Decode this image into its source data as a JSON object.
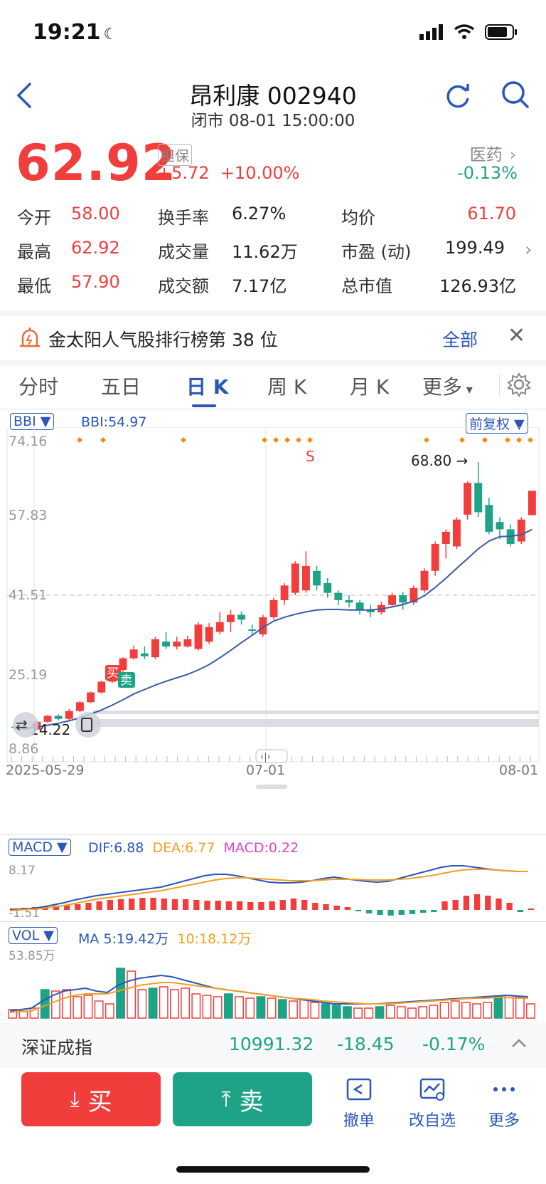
{
  "status": {
    "time": "19:21"
  },
  "header": {
    "title": "昂利康 002940",
    "subtitle": "闭市 08-01 15:00:00"
  },
  "quote": {
    "price": "62.92",
    "badge": "担保",
    "change": "+5.72",
    "change_pct": "+10.00%",
    "sector": "医药",
    "sector_change": "-0.13%"
  },
  "stats": [
    {
      "label": "今开",
      "value": "58.00",
      "tone": "red"
    },
    {
      "label": "换手率",
      "value": "6.27%",
      "tone": "dark"
    },
    {
      "label": "均价",
      "value": "61.70",
      "tone": "red"
    },
    {
      "label": "最高",
      "value": "62.92",
      "tone": "red"
    },
    {
      "label": "成交量",
      "value": "11.62万",
      "tone": "dark"
    },
    {
      "label": "市盈 (动)",
      "value": "199.49",
      "tone": "dark"
    },
    {
      "label": "最低",
      "value": "57.90",
      "tone": "red"
    },
    {
      "label": "成交额",
      "value": "7.17亿",
      "tone": "dark"
    },
    {
      "label": "总市值",
      "value": "126.93亿",
      "tone": "dark"
    }
  ],
  "banner": {
    "text": "金太阳人气股排行榜第 38 位",
    "link": "全部"
  },
  "tabs": [
    "分时",
    "五日",
    "日 K",
    "周 K",
    "月 K",
    "更多"
  ],
  "active_tab": "日 K",
  "kline": {
    "indicator": "BBI",
    "indicator_value": "BBI:54.97",
    "adjust": "前复权",
    "y_ticks": [
      "74.16",
      "57.83",
      "41.51",
      "25.19",
      "8.86"
    ],
    "x_ticks": [
      "2025-05-29",
      "07-01",
      "08-01"
    ],
    "high_label": "68.80",
    "low_label": "14.22",
    "buy_label": "买",
    "sell_label": "卖",
    "s_label": "S",
    "colors": {
      "up": "#f23d3d",
      "down": "#1fa387",
      "ma": "#3a5aa8"
    }
  },
  "chart_data": {
    "type": "candlestick",
    "ylim": [
      8.86,
      74.16
    ],
    "y_ticks": [
      74.16,
      57.83,
      41.51,
      25.19,
      8.86
    ],
    "x_ticks": [
      "2025-05-29",
      "07-01",
      "08-01"
    ],
    "candles": [
      [
        14.6,
        14.3,
        14.9,
        14.0
      ],
      [
        14.3,
        14.0,
        14.6,
        13.8
      ],
      [
        14.0,
        15.6,
        15.9,
        13.9
      ],
      [
        15.6,
        16.8,
        17.0,
        15.4
      ],
      [
        16.8,
        16.2,
        17.1,
        15.9
      ],
      [
        16.2,
        17.8,
        18.2,
        16.0
      ],
      [
        17.8,
        19.6,
        19.8,
        17.6
      ],
      [
        19.6,
        21.6,
        21.8,
        19.4
      ],
      [
        21.6,
        23.8,
        24.0,
        21.4
      ],
      [
        23.8,
        26.2,
        26.4,
        23.6
      ],
      [
        26.2,
        28.6,
        28.8,
        25.8
      ],
      [
        28.6,
        30.4,
        31.2,
        28.3
      ],
      [
        29.6,
        29.0,
        31.0,
        28.4
      ],
      [
        28.8,
        32.5,
        33.0,
        28.4
      ],
      [
        32.0,
        31.0,
        34.0,
        30.5
      ],
      [
        31.0,
        32.0,
        33.0,
        30.4
      ],
      [
        31.0,
        32.5,
        33.2,
        30.8
      ],
      [
        30.5,
        35.5,
        36.0,
        30.2
      ],
      [
        32.0,
        35.0,
        35.8,
        31.5
      ],
      [
        34.0,
        36.0,
        38.0,
        33.5
      ],
      [
        36.0,
        37.5,
        38.5,
        34.0
      ],
      [
        37.5,
        36.5,
        38.2,
        35.5
      ],
      [
        34.5,
        34.2,
        35.5,
        33.5
      ],
      [
        33.5,
        37.0,
        37.5,
        33.0
      ],
      [
        37.0,
        40.5,
        41.0,
        36.5
      ],
      [
        40.5,
        43.5,
        44.0,
        39.5
      ],
      [
        42.0,
        48.0,
        48.5,
        41.5
      ],
      [
        42.5,
        47.5,
        50.5,
        42.0
      ],
      [
        46.5,
        43.5,
        47.5,
        42.5
      ],
      [
        44.0,
        42.0,
        45.0,
        41.0
      ],
      [
        42.0,
        40.5,
        42.5,
        39.5
      ],
      [
        40.5,
        40.0,
        41.5,
        39.0
      ],
      [
        40.0,
        38.5,
        40.5,
        37.5
      ],
      [
        38.5,
        38.0,
        39.5,
        37.0
      ],
      [
        38.0,
        39.5,
        40.2,
        37.5
      ],
      [
        39.5,
        41.5,
        42.0,
        39.0
      ],
      [
        41.5,
        40.0,
        42.2,
        38.5
      ],
      [
        40.0,
        43.0,
        43.5,
        39.5
      ],
      [
        42.5,
        46.5,
        47.0,
        42.0
      ],
      [
        46.5,
        52.0,
        52.5,
        45.5
      ],
      [
        52.0,
        54.5,
        55.0,
        49.0
      ],
      [
        51.5,
        57.0,
        57.5,
        51.0
      ],
      [
        58.0,
        64.5,
        64.8,
        57.0
      ],
      [
        64.5,
        58.5,
        68.8,
        57.5
      ],
      [
        60.0,
        54.5,
        61.5,
        54.0
      ],
      [
        56.5,
        55.0,
        57.5,
        53.0
      ],
      [
        55.0,
        52.0,
        56.0,
        51.5
      ],
      [
        52.5,
        57.0,
        57.5,
        52.0
      ],
      [
        57.9,
        62.9,
        62.9,
        57.9
      ]
    ],
    "bbi": [
      14.2,
      14.3,
      14.5,
      14.9,
      15.3,
      15.8,
      16.4,
      17.2,
      18.0,
      19.0,
      20.1,
      21.3,
      22.2,
      23.1,
      23.9,
      24.6,
      25.3,
      26.2,
      27.3,
      28.7,
      30.2,
      31.8,
      33.3,
      34.9,
      36.2,
      37.0,
      37.6,
      38.1,
      38.5,
      38.6,
      38.6,
      38.5,
      38.5,
      38.5,
      38.7,
      39.1,
      39.6,
      40.3,
      41.4,
      43.1,
      45.0,
      47.0,
      49.0,
      51.0,
      52.6,
      53.5,
      53.6,
      53.9,
      54.97
    ],
    "macd": {
      "dif": "6.88",
      "dea": "6.77",
      "macd": "0.22",
      "y_ticks": [
        "8.17",
        "-1.51"
      ]
    },
    "vol": {
      "ma5": "5:19.42万",
      "ma10": "10:18.12万",
      "y_tick": "53.85万"
    }
  },
  "bottom": {
    "index_name": "深证成指",
    "index_value": "10991.32",
    "index_change": "-18.45",
    "index_pct": "-0.17%",
    "buy_label": "买",
    "sell_label": "卖",
    "tools": [
      "撤单",
      "改自选",
      "更多"
    ]
  }
}
